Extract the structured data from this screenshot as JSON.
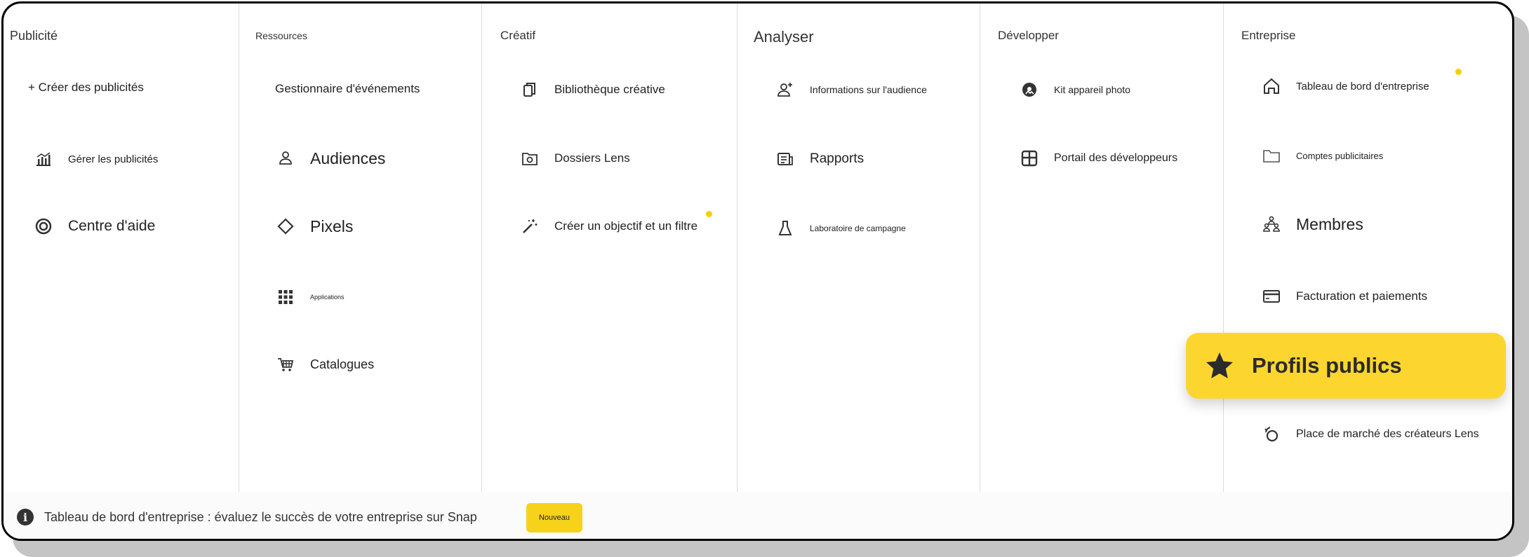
{
  "columns": {
    "publicite": {
      "title": "Publicité",
      "items": [
        {
          "label": "+ Créer des publicités"
        },
        {
          "label": "Gérer les publicités",
          "icon": "bar-chart-icon"
        },
        {
          "label": "Centre d'aide",
          "icon": "help-ring-icon"
        }
      ]
    },
    "ressources": {
      "title": "Ressources",
      "items": [
        {
          "label": "Gestionnaire d'événements"
        },
        {
          "label": "Audiences",
          "icon": "person-icon"
        },
        {
          "label": "Pixels",
          "icon": "diamond-icon"
        },
        {
          "label": "Applications",
          "icon": "grid-icon"
        },
        {
          "label": "Catalogues",
          "icon": "cart-icon"
        }
      ]
    },
    "creatif": {
      "title": "Créatif",
      "items": [
        {
          "label": "Bibliothèque créative",
          "icon": "copy-icon"
        },
        {
          "label": "Dossiers Lens",
          "icon": "folder-lens-icon"
        },
        {
          "label": "Créer un objectif et un filtre",
          "icon": "magic-wand-icon"
        }
      ]
    },
    "analyser": {
      "title": "Analyser",
      "items": [
        {
          "label": "Informations sur l'audience",
          "icon": "person-add-icon"
        },
        {
          "label": "Rapports",
          "icon": "report-icon"
        },
        {
          "label": "Laboratoire de campagne",
          "icon": "flask-icon"
        }
      ]
    },
    "developper": {
      "title": "Développer",
      "items": [
        {
          "label": "Kit appareil photo",
          "icon": "camera-kit-icon"
        },
        {
          "label": "Portail des développeurs",
          "icon": "dev-portal-icon"
        }
      ]
    },
    "entreprise": {
      "title": "Entreprise",
      "items": [
        {
          "label": "Tableau de bord d'entreprise",
          "icon": "home-icon"
        },
        {
          "label": "Comptes publicitaires",
          "icon": "folder-icon"
        },
        {
          "label": "Membres",
          "icon": "members-icon"
        },
        {
          "label": "Facturation et paiements",
          "icon": "card-icon"
        },
        {
          "label": "Profils publics",
          "icon": "star-icon"
        },
        {
          "label": "Place de marché des créateurs Lens",
          "icon": "lens-market-icon"
        }
      ]
    }
  },
  "footer": {
    "text": "Tableau de bord d'entreprise : évaluez le succès de votre entreprise sur Snap",
    "badge": "Nouveau",
    "icon": "info-icon"
  },
  "colors": {
    "accent": "#FCD62F",
    "dot": "#F5D000",
    "border": "#000000"
  }
}
